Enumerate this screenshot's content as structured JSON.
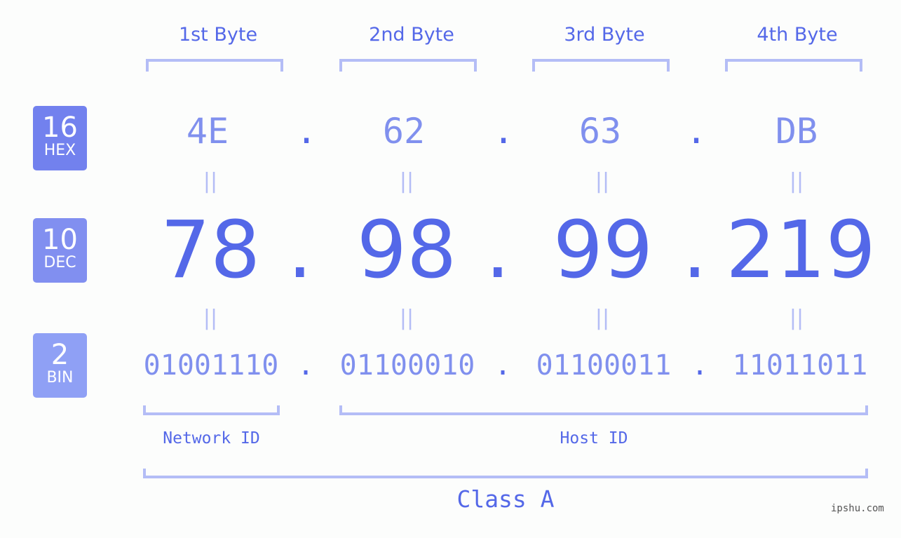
{
  "bytes": [
    {
      "label": "1st Byte",
      "hex": "4E",
      "dec": "78",
      "bin": "01001110"
    },
    {
      "label": "2nd Byte",
      "hex": "62",
      "dec": "98",
      "bin": "01100010"
    },
    {
      "label": "3rd Byte",
      "hex": "63",
      "dec": "99",
      "bin": "01100011"
    },
    {
      "label": "4th Byte",
      "hex": "DB",
      "dec": "219",
      "bin": "11011011"
    }
  ],
  "separator": ".",
  "equals": "||",
  "badges": {
    "hex": {
      "num": "16",
      "label": "HEX",
      "color": "#7281ee"
    },
    "dec": {
      "num": "10",
      "label": "DEC",
      "color": "#818ff0"
    },
    "bin": {
      "num": "2",
      "label": "BIN",
      "color": "#8fa0f5"
    }
  },
  "network_label": "Network ID",
  "host_label": "Host ID",
  "class_label": "Class A",
  "watermark": "ipshu.com"
}
